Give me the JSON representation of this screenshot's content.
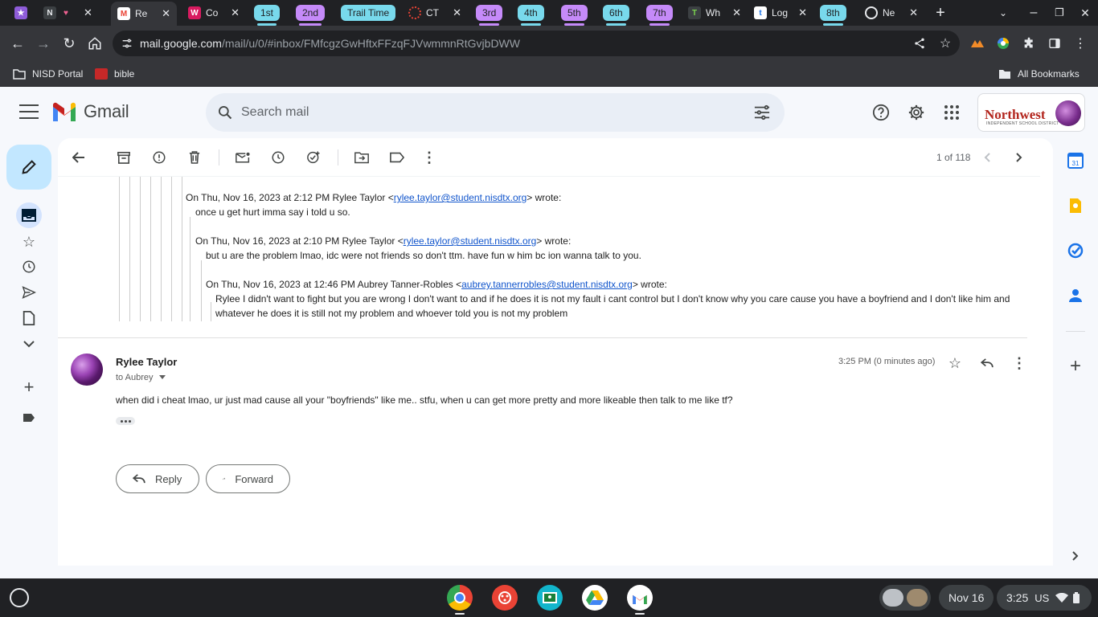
{
  "browser": {
    "tabs": [
      {
        "label": "Re",
        "active": true
      },
      {
        "label": "Co"
      },
      {
        "label": "CT"
      },
      {
        "label": "Wh"
      },
      {
        "label": "Log"
      },
      {
        "label": "Ne"
      }
    ],
    "tab_groups": [
      "1st",
      "2nd",
      "Trail Time",
      "3rd",
      "4th",
      "5th",
      "6th",
      "7th",
      "8th"
    ],
    "url_host": "mail.google.com",
    "url_path": "/mail/u/0/#inbox/FMfcgzGwHftxFFzqFJVwmmnRtGvjbDWW",
    "bookmarks": [
      "NISD Portal",
      "bible"
    ],
    "all_bookmarks_label": "All Bookmarks"
  },
  "gmail": {
    "logo_text": "Gmail",
    "search_placeholder": "Search mail",
    "account_org": "Northwest",
    "account_org_sub": "INDEPENDENT SCHOOL DISTRICT",
    "pager": "1 of 118",
    "quoted": [
      {
        "prefix": "On Thu, Nov 16, 2023 at 2:12 PM Rylee Taylor <",
        "email": "rylee.taylor@student.nisdtx.org",
        "suffix": "> wrote:"
      },
      {
        "text": "once u get hurt imma say i told u so."
      },
      {
        "prefix": "On Thu, Nov 16, 2023 at 2:10 PM Rylee Taylor <",
        "email": "rylee.taylor@student.nisdtx.org",
        "suffix": "> wrote:"
      },
      {
        "text": "but u are the problem lmao, idc were not friends so don't ttm. have fun w him bc ion wanna talk to you."
      },
      {
        "prefix": "On Thu, Nov 16, 2023 at 12:46 PM Aubrey Tanner-Robles <",
        "email": "aubrey.tannerrobles@student.nisdtx.org",
        "suffix": "> wrote:"
      },
      {
        "text": "Rylee I didn't want to fight but you are wrong I don't want to and if he does it is not my fault i cant control but I don't know why you care cause you have a boyfriend and I don't like him and"
      },
      {
        "text": "whatever  he does it is still not my problem and whoever told you is not my problem"
      }
    ],
    "message": {
      "sender": "Rylee Taylor",
      "recipient": "to Aubrey",
      "time": "3:25 PM (0 minutes ago)",
      "body": "when did i cheat lmao, ur just mad cause all your \"boyfriends\" like me.. stfu, when u can get more pretty and more likeable then talk to me like tf?"
    },
    "reply_label": "Reply",
    "forward_label": "Forward"
  },
  "shelf": {
    "date": "Nov 16",
    "time": "3:25",
    "locale": "US"
  },
  "colors": {
    "accent": "#0b57d0",
    "compose_bg": "#c2e7ff",
    "link": "#1155cc"
  }
}
